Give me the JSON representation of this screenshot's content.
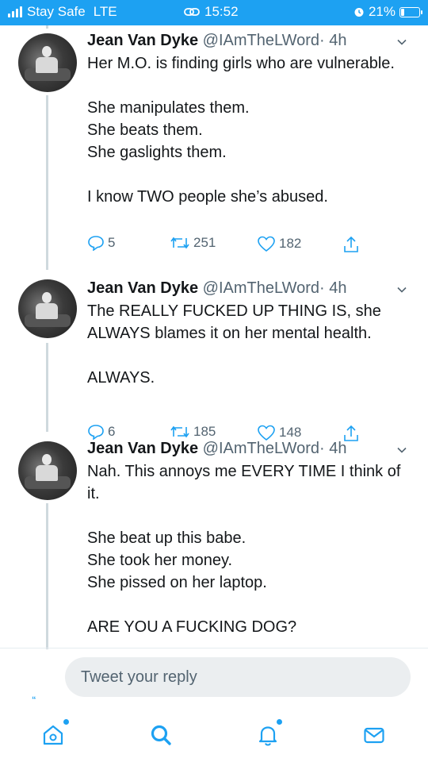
{
  "status_bar": {
    "carrier": "Stay Safe",
    "network": "LTE",
    "time": "15:52",
    "battery": "21%",
    "battery_level": 0.21
  },
  "tweets": [
    {
      "name": "Jean Van Dyke",
      "handle": "@IAmTheLWord",
      "time": "· 4h",
      "text": "Her M.O. is finding girls who are vulnerable.\n\nShe manipulates them.\nShe beats them.\nShe gaslights them.\n\nI know TWO people she’s abused.",
      "replies": "5",
      "retweets": "251",
      "likes": "182"
    },
    {
      "name": "Jean Van Dyke",
      "handle": "@IAmTheLWord",
      "time": "· 4h",
      "text": "The REALLY FUCKED UP THING IS, she ALWAYS blames it on her mental health.\n\nALWAYS.",
      "replies": "6",
      "retweets": "185",
      "likes": "148"
    },
    {
      "name": "Jean Van Dyke",
      "handle": "@IAmTheLWord",
      "time": "· 4h",
      "text": "Nah. This annoys me EVERY TIME I think of it.\n\nShe beat up this babe.\nShe took her money.\nShe pissed on her laptop.\n\nARE YOU A FUCKING DOG?"
    }
  ],
  "reply": {
    "placeholder": "Tweet your reply",
    "quote_mark": "“"
  },
  "nav": {
    "items": [
      "home-icon",
      "search-icon",
      "notifications-icon",
      "messages-icon"
    ],
    "accent": "#1da1f2"
  },
  "colors": {
    "status_bar": "#1da1f2",
    "text": "#14171a",
    "secondary": "#536471",
    "accent": "#1da1f2"
  }
}
